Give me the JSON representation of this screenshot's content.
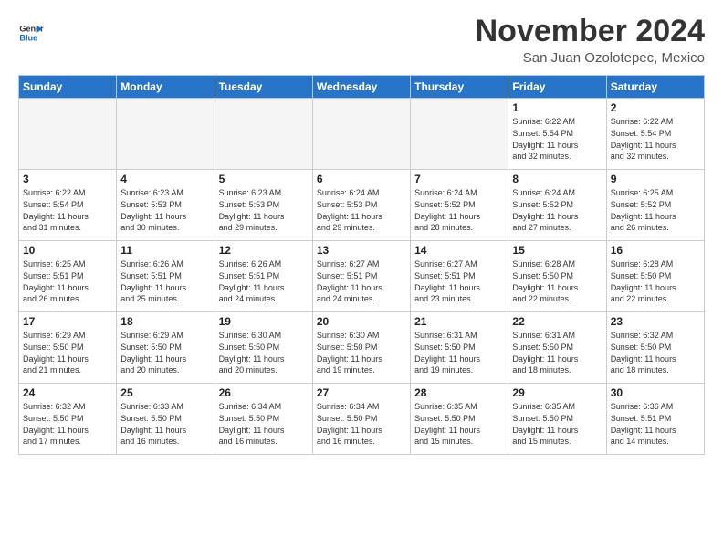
{
  "logo": {
    "line1": "General",
    "line2": "Blue"
  },
  "title": "November 2024",
  "location": "San Juan Ozolotepec, Mexico",
  "days_of_week": [
    "Sunday",
    "Monday",
    "Tuesday",
    "Wednesday",
    "Thursday",
    "Friday",
    "Saturday"
  ],
  "weeks": [
    [
      {
        "day": "",
        "info": ""
      },
      {
        "day": "",
        "info": ""
      },
      {
        "day": "",
        "info": ""
      },
      {
        "day": "",
        "info": ""
      },
      {
        "day": "",
        "info": ""
      },
      {
        "day": "1",
        "info": "Sunrise: 6:22 AM\nSunset: 5:54 PM\nDaylight: 11 hours\nand 32 minutes."
      },
      {
        "day": "2",
        "info": "Sunrise: 6:22 AM\nSunset: 5:54 PM\nDaylight: 11 hours\nand 32 minutes."
      }
    ],
    [
      {
        "day": "3",
        "info": "Sunrise: 6:22 AM\nSunset: 5:54 PM\nDaylight: 11 hours\nand 31 minutes."
      },
      {
        "day": "4",
        "info": "Sunrise: 6:23 AM\nSunset: 5:53 PM\nDaylight: 11 hours\nand 30 minutes."
      },
      {
        "day": "5",
        "info": "Sunrise: 6:23 AM\nSunset: 5:53 PM\nDaylight: 11 hours\nand 29 minutes."
      },
      {
        "day": "6",
        "info": "Sunrise: 6:24 AM\nSunset: 5:53 PM\nDaylight: 11 hours\nand 29 minutes."
      },
      {
        "day": "7",
        "info": "Sunrise: 6:24 AM\nSunset: 5:52 PM\nDaylight: 11 hours\nand 28 minutes."
      },
      {
        "day": "8",
        "info": "Sunrise: 6:24 AM\nSunset: 5:52 PM\nDaylight: 11 hours\nand 27 minutes."
      },
      {
        "day": "9",
        "info": "Sunrise: 6:25 AM\nSunset: 5:52 PM\nDaylight: 11 hours\nand 26 minutes."
      }
    ],
    [
      {
        "day": "10",
        "info": "Sunrise: 6:25 AM\nSunset: 5:51 PM\nDaylight: 11 hours\nand 26 minutes."
      },
      {
        "day": "11",
        "info": "Sunrise: 6:26 AM\nSunset: 5:51 PM\nDaylight: 11 hours\nand 25 minutes."
      },
      {
        "day": "12",
        "info": "Sunrise: 6:26 AM\nSunset: 5:51 PM\nDaylight: 11 hours\nand 24 minutes."
      },
      {
        "day": "13",
        "info": "Sunrise: 6:27 AM\nSunset: 5:51 PM\nDaylight: 11 hours\nand 24 minutes."
      },
      {
        "day": "14",
        "info": "Sunrise: 6:27 AM\nSunset: 5:51 PM\nDaylight: 11 hours\nand 23 minutes."
      },
      {
        "day": "15",
        "info": "Sunrise: 6:28 AM\nSunset: 5:50 PM\nDaylight: 11 hours\nand 22 minutes."
      },
      {
        "day": "16",
        "info": "Sunrise: 6:28 AM\nSunset: 5:50 PM\nDaylight: 11 hours\nand 22 minutes."
      }
    ],
    [
      {
        "day": "17",
        "info": "Sunrise: 6:29 AM\nSunset: 5:50 PM\nDaylight: 11 hours\nand 21 minutes."
      },
      {
        "day": "18",
        "info": "Sunrise: 6:29 AM\nSunset: 5:50 PM\nDaylight: 11 hours\nand 20 minutes."
      },
      {
        "day": "19",
        "info": "Sunrise: 6:30 AM\nSunset: 5:50 PM\nDaylight: 11 hours\nand 20 minutes."
      },
      {
        "day": "20",
        "info": "Sunrise: 6:30 AM\nSunset: 5:50 PM\nDaylight: 11 hours\nand 19 minutes."
      },
      {
        "day": "21",
        "info": "Sunrise: 6:31 AM\nSunset: 5:50 PM\nDaylight: 11 hours\nand 19 minutes."
      },
      {
        "day": "22",
        "info": "Sunrise: 6:31 AM\nSunset: 5:50 PM\nDaylight: 11 hours\nand 18 minutes."
      },
      {
        "day": "23",
        "info": "Sunrise: 6:32 AM\nSunset: 5:50 PM\nDaylight: 11 hours\nand 18 minutes."
      }
    ],
    [
      {
        "day": "24",
        "info": "Sunrise: 6:32 AM\nSunset: 5:50 PM\nDaylight: 11 hours\nand 17 minutes."
      },
      {
        "day": "25",
        "info": "Sunrise: 6:33 AM\nSunset: 5:50 PM\nDaylight: 11 hours\nand 16 minutes."
      },
      {
        "day": "26",
        "info": "Sunrise: 6:34 AM\nSunset: 5:50 PM\nDaylight: 11 hours\nand 16 minutes."
      },
      {
        "day": "27",
        "info": "Sunrise: 6:34 AM\nSunset: 5:50 PM\nDaylight: 11 hours\nand 16 minutes."
      },
      {
        "day": "28",
        "info": "Sunrise: 6:35 AM\nSunset: 5:50 PM\nDaylight: 11 hours\nand 15 minutes."
      },
      {
        "day": "29",
        "info": "Sunrise: 6:35 AM\nSunset: 5:50 PM\nDaylight: 11 hours\nand 15 minutes."
      },
      {
        "day": "30",
        "info": "Sunrise: 6:36 AM\nSunset: 5:51 PM\nDaylight: 11 hours\nand 14 minutes."
      }
    ]
  ]
}
